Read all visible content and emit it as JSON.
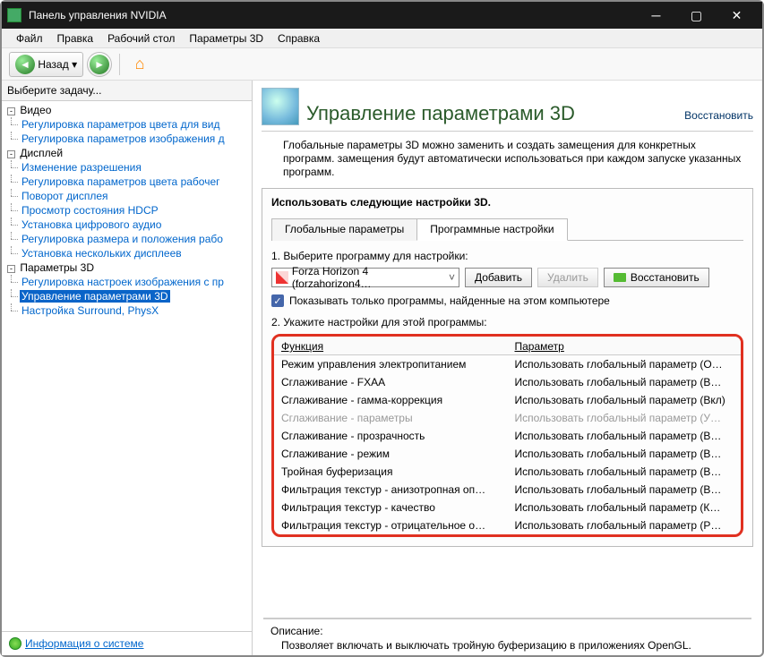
{
  "window": {
    "title": "Панель управления NVIDIA"
  },
  "menu": {
    "file": "Файл",
    "edit": "Правка",
    "desktop": "Рабочий стол",
    "params3d": "Параметры 3D",
    "help": "Справка"
  },
  "toolbar": {
    "back_label": "Назад"
  },
  "sidebar": {
    "select_task": "Выберите задачу...",
    "video": "Видео",
    "video_items": [
      "Регулировка параметров цвета для вид",
      "Регулировка параметров изображения д"
    ],
    "display": "Дисплей",
    "display_items": [
      "Изменение разрешения",
      "Регулировка параметров цвета рабочег",
      "Поворот дисплея",
      "Просмотр состояния HDCP",
      "Установка цифрового аудио",
      "Регулировка размера и положения рабо",
      "Установка нескольких дисплеев"
    ],
    "params3d": "Параметры 3D",
    "params3d_items": [
      "Регулировка настроек изображения с пр",
      "Управление параметрами 3D",
      "Настройка Surround, PhysX"
    ],
    "sysinfo": "Информация о системе"
  },
  "content": {
    "title": "Управление параметрами 3D",
    "restore": "Восстановить",
    "description": "Глобальные параметры 3D можно заменить и создать замещения для конкретных программ. замещения будут автоматически использоваться при каждом запуске указанных программ.",
    "panel_title": "Использовать следующие настройки 3D.",
    "tabs": {
      "global": "Глобальные параметры",
      "program": "Программные настройки"
    },
    "step1": "1. Выберите программу для настройки:",
    "program_selected": "Forza Horizon 4 (forzahorizon4…",
    "btn_add": "Добавить",
    "btn_remove": "Удалить",
    "btn_restore": "Восстановить",
    "checkbox_label": "Показывать только программы, найденные на этом компьютере",
    "step2": "2. Укажите настройки для этой программы:",
    "col_function": "Функция",
    "col_param": "Параметр",
    "rows": [
      {
        "f": "Режим управления электропитанием",
        "p": "Использовать глобальный параметр (О…",
        "dis": false
      },
      {
        "f": "Сглаживание - FXAA",
        "p": "Использовать глобальный параметр (В…",
        "dis": false
      },
      {
        "f": "Сглаживание - гамма-коррекция",
        "p": "Использовать глобальный параметр (Вкл)",
        "dis": false
      },
      {
        "f": "Сглаживание - параметры",
        "p": "Использовать глобальный параметр (У…",
        "dis": true
      },
      {
        "f": "Сглаживание - прозрачность",
        "p": "Использовать глобальный параметр (В…",
        "dis": false
      },
      {
        "f": "Сглаживание - режим",
        "p": "Использовать глобальный параметр (В…",
        "dis": false
      },
      {
        "f": "Тройная буферизация",
        "p": "Использовать глобальный параметр (В…",
        "dis": false
      },
      {
        "f": "Фильтрация текстур - анизотропная оп…",
        "p": "Использовать глобальный параметр (В…",
        "dis": false
      },
      {
        "f": "Фильтрация текстур - качество",
        "p": "Использовать глобальный параметр (К…",
        "dis": false
      },
      {
        "f": "Фильтрация текстур - отрицательное о…",
        "p": "Использовать глобальный параметр (Р…",
        "dis": false
      }
    ],
    "footer_title": "Описание:",
    "footer_text": "Позволяет включать и выключать тройную буферизацию в приложениях OpenGL."
  }
}
